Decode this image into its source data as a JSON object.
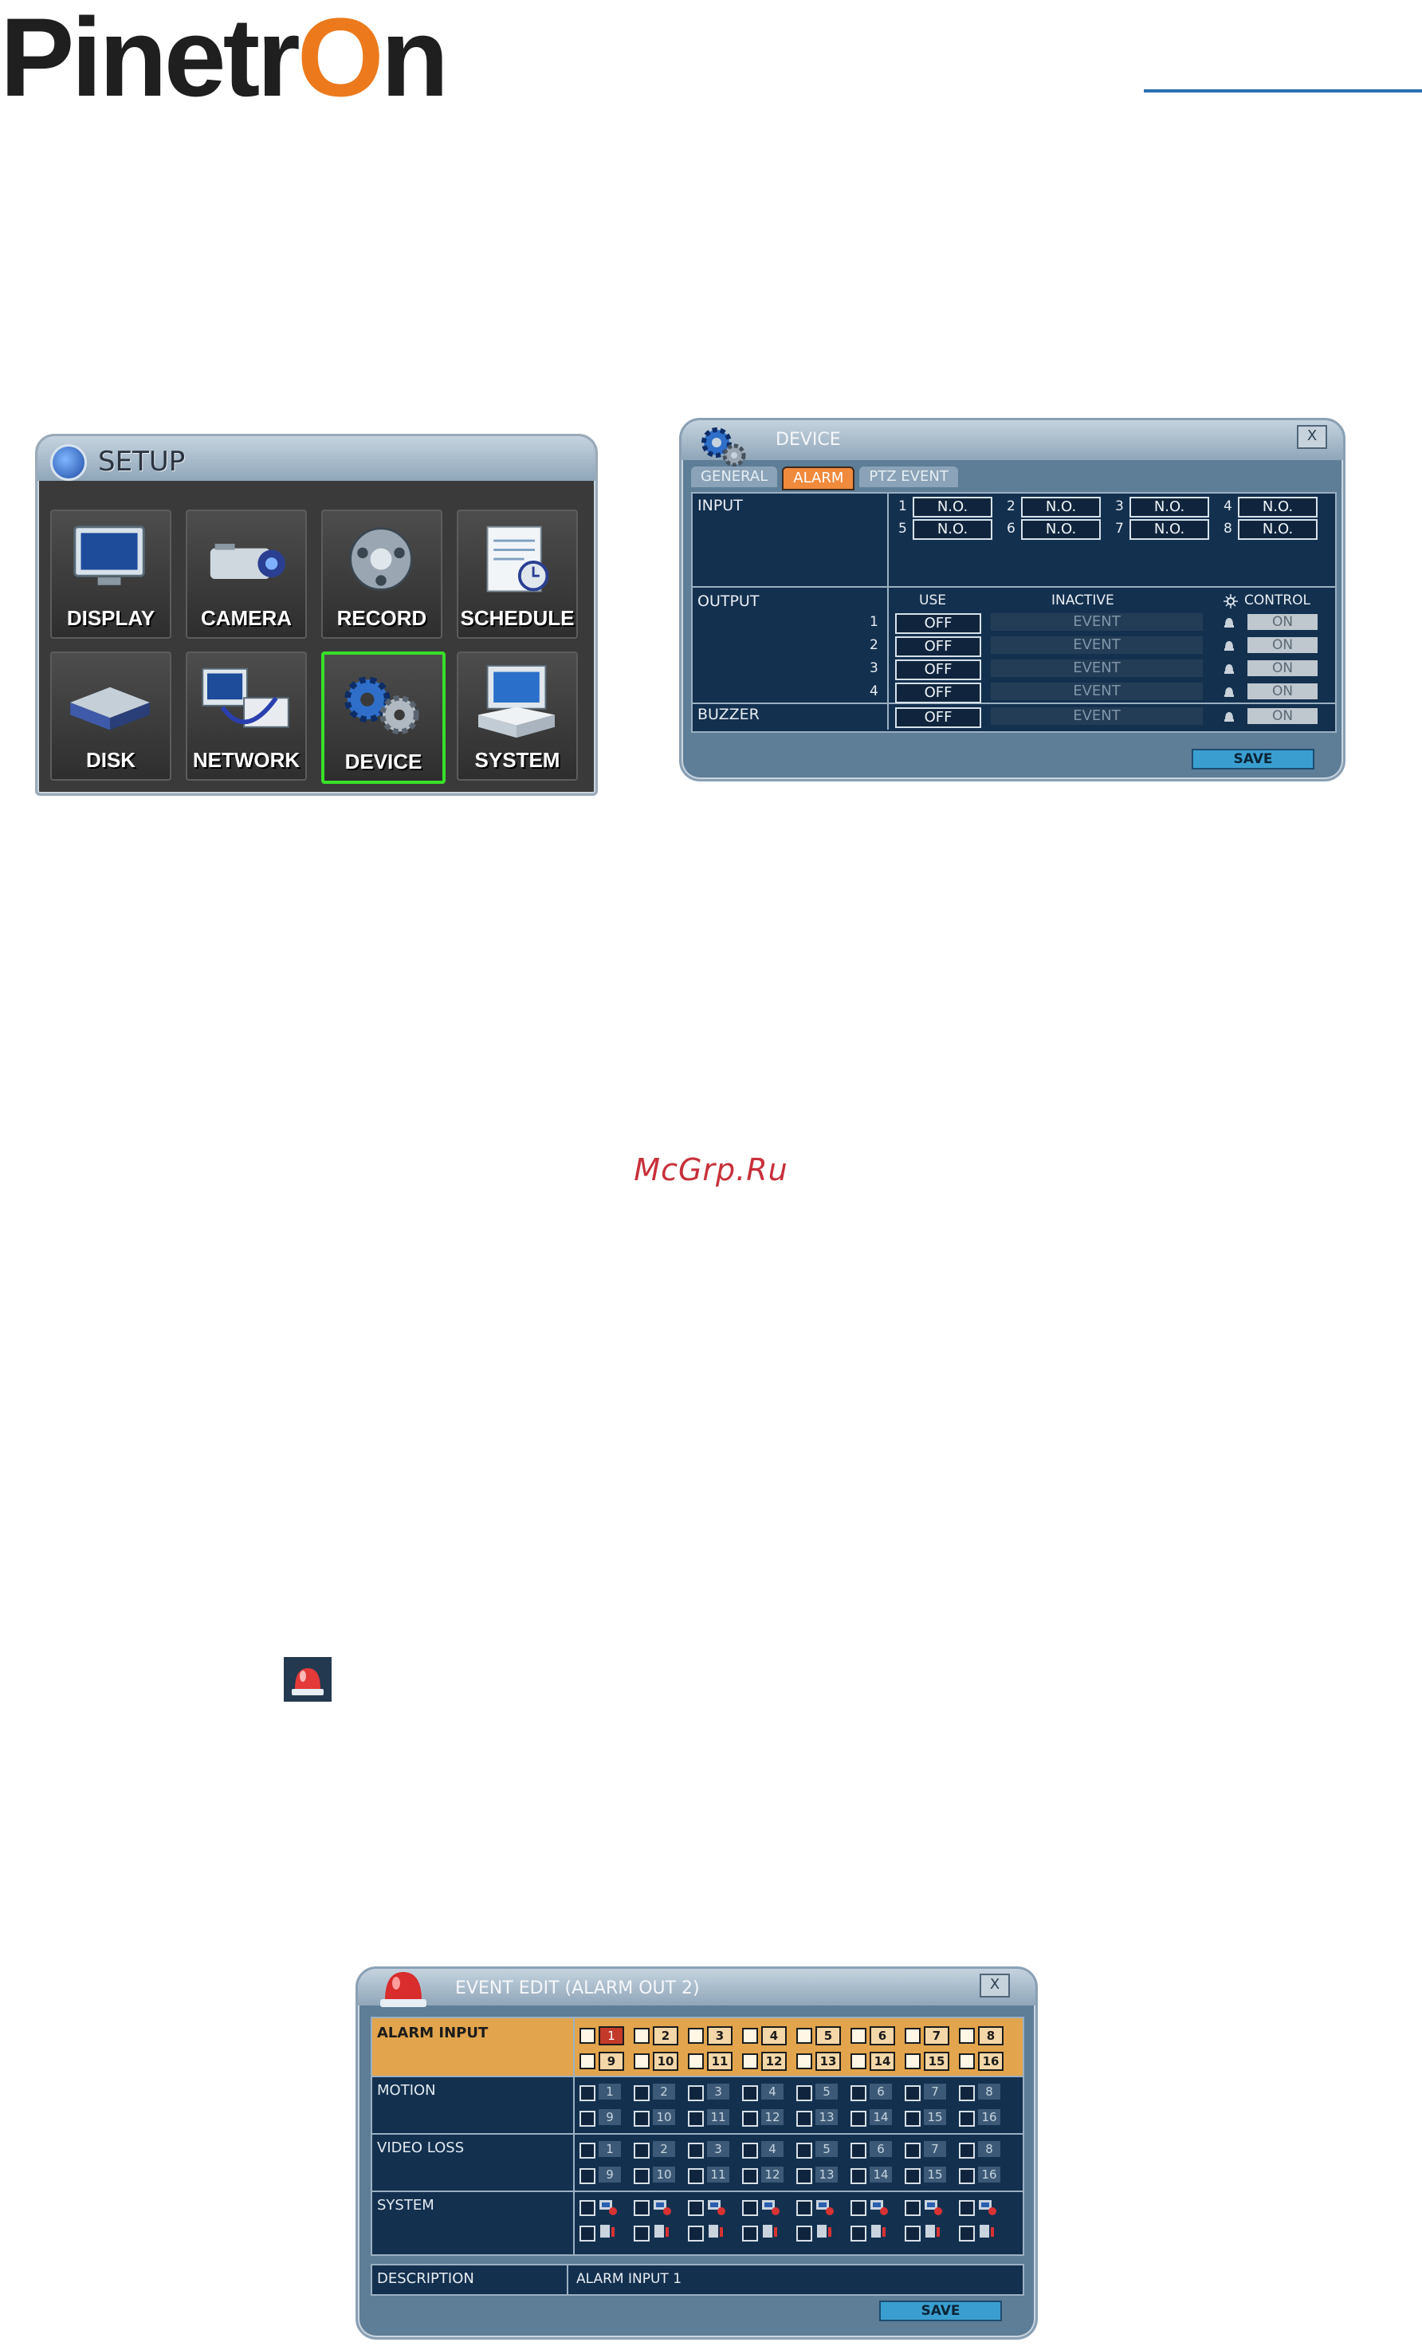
{
  "logo": {
    "text_a": "Pinetr",
    "text_o": "O",
    "text_b": "n"
  },
  "watermark": "McGrp.Ru",
  "setup": {
    "title": "SETUP",
    "tiles": [
      "DISPLAY",
      "CAMERA",
      "RECORD",
      "SCHEDULE",
      "DISK",
      "NETWORK",
      "DEVICE",
      "SYSTEM"
    ],
    "selected": "DEVICE"
  },
  "device": {
    "title": "DEVICE",
    "close": "X",
    "tabs": [
      "GENERAL",
      "ALARM",
      "PTZ EVENT"
    ],
    "active_tab": "ALARM",
    "input_label": "INPUT",
    "inputs": [
      {
        "n": "1",
        "v": "N.O."
      },
      {
        "n": "2",
        "v": "N.O."
      },
      {
        "n": "3",
        "v": "N.O."
      },
      {
        "n": "4",
        "v": "N.O."
      },
      {
        "n": "5",
        "v": "N.O."
      },
      {
        "n": "6",
        "v": "N.O."
      },
      {
        "n": "7",
        "v": "N.O."
      },
      {
        "n": "8",
        "v": "N.O."
      }
    ],
    "output_label": "OUTPUT",
    "col_use": "USE",
    "col_inactive": "INACTIVE",
    "col_control": "CONTROL",
    "outputs": [
      {
        "n": "1",
        "use": "OFF",
        "inactive": "EVENT",
        "control": "ON"
      },
      {
        "n": "2",
        "use": "OFF",
        "inactive": "EVENT",
        "control": "ON"
      },
      {
        "n": "3",
        "use": "OFF",
        "inactive": "EVENT",
        "control": "ON"
      },
      {
        "n": "4",
        "use": "OFF",
        "inactive": "EVENT",
        "control": "ON"
      }
    ],
    "buzzer_label": "BUZZER",
    "buzzer": {
      "use": "OFF",
      "inactive": "EVENT",
      "control": "ON"
    },
    "save": "SAVE"
  },
  "event_edit": {
    "title": "EVENT EDIT (ALARM OUT 2)",
    "close": "X",
    "rows": [
      {
        "label": "ALARM INPUT",
        "kind": "num"
      },
      {
        "label": "MOTION",
        "kind": "num"
      },
      {
        "label": "VIDEO LOSS",
        "kind": "num"
      },
      {
        "label": "SYSTEM",
        "kind": "icon"
      }
    ],
    "numbers": [
      "1",
      "2",
      "3",
      "4",
      "5",
      "6",
      "7",
      "8",
      "9",
      "10",
      "11",
      "12",
      "13",
      "14",
      "15",
      "16"
    ],
    "description_label": "DESCRIPTION",
    "description_value": "ALARM INPUT 1",
    "save": "SAVE"
  },
  "colors": {
    "accent_orange": "#f08a3c",
    "panel_navy": "#13304f",
    "highlight_row": "#e2a54d",
    "select_green": "#38e028",
    "logo_orange": "#ec7a1c",
    "rule_blue": "#2a6fb5"
  }
}
